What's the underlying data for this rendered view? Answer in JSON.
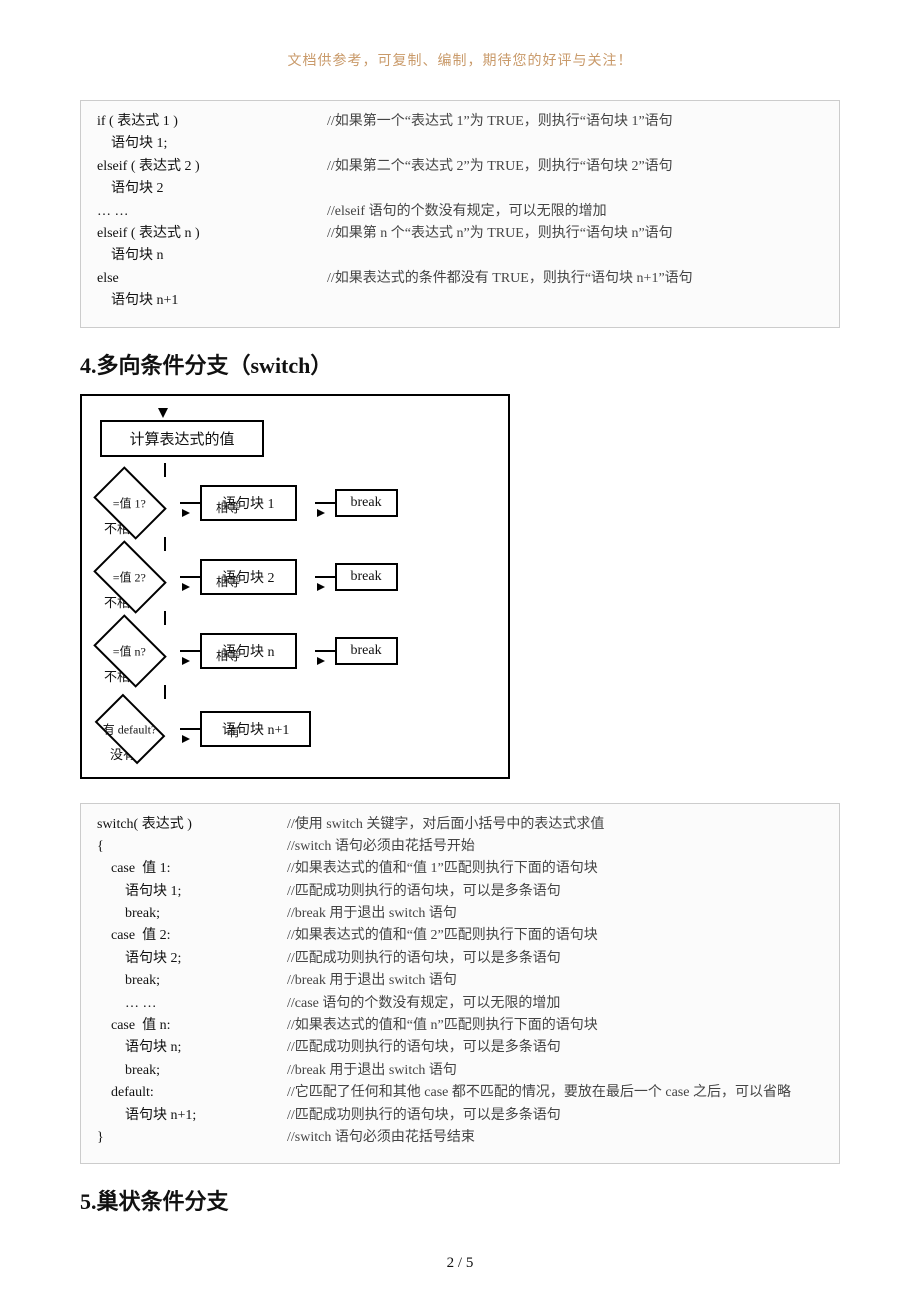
{
  "header_note": "文档供参考，可复制、编制，期待您的好评与关注！",
  "if_block": {
    "rows": [
      {
        "code": "if ( 表达式 1 )",
        "comment": "//如果第一个“表达式 1”为 TRUE，则执行“语句块 1”语句"
      },
      {
        "code": "    语句块 1;",
        "comment": ""
      },
      {
        "code": "elseif ( 表达式 2 )",
        "comment": "//如果第二个“表达式 2”为 TRUE，则执行“语句块 2”语句"
      },
      {
        "code": "    语句块 2",
        "comment": ""
      },
      {
        "code": "… …",
        "comment": "//elseif 语句的个数没有规定，可以无限的增加"
      },
      {
        "code": "elseif ( 表达式 n )",
        "comment": "//如果第 n 个“表达式 n”为 TRUE，则执行“语句块 n”语句"
      },
      {
        "code": "    语句块 n",
        "comment": ""
      },
      {
        "code": "else",
        "comment": "//如果表达式的条件都没有 TRUE，则执行“语句块 n+1”语句"
      },
      {
        "code": "    语句块 n+1",
        "comment": ""
      }
    ]
  },
  "section4_title": "4.多向条件分支（switch）",
  "flowchart": {
    "start": "计算表达式的值",
    "eq_label": "相等",
    "neq_label": "不相等",
    "has_label": "有",
    "none_label": "没有",
    "nodes": [
      {
        "q": "=值 1?",
        "stmt": "语句块 1",
        "brk": "break"
      },
      {
        "q": "=值 2?",
        "stmt": "语句块 2",
        "brk": "break"
      },
      {
        "q": "=值 n?",
        "stmt": "语句块 n",
        "brk": "break"
      }
    ],
    "default_q": "有 default?",
    "default_stmt": "语句块 n+1"
  },
  "switch_block": {
    "rows": [
      {
        "code": "switch( 表达式 )",
        "comment": "//使用 switch 关键字，对后面小括号中的表达式求值"
      },
      {
        "code": "{",
        "comment": "//switch 语句必须由花括号开始"
      },
      {
        "code": "    case  值 1:",
        "comment": "//如果表达式的值和“值 1”匹配则执行下面的语句块"
      },
      {
        "code": "        语句块 1;",
        "comment": "//匹配成功则执行的语句块，可以是多条语句"
      },
      {
        "code": "        break;",
        "comment": "//break 用于退出 switch 语句"
      },
      {
        "code": "    case  值 2:",
        "comment": "//如果表达式的值和“值 2”匹配则执行下面的语句块"
      },
      {
        "code": "        语句块 2;",
        "comment": "//匹配成功则执行的语句块，可以是多条语句"
      },
      {
        "code": "        break;",
        "comment": "//break 用于退出 switch 语句"
      },
      {
        "code": "        … …",
        "comment": "//case 语句的个数没有规定，可以无限的增加"
      },
      {
        "code": "    case  值 n:",
        "comment": "//如果表达式的值和“值 n”匹配则执行下面的语句块"
      },
      {
        "code": "        语句块 n;",
        "comment": "//匹配成功则执行的语句块，可以是多条语句"
      },
      {
        "code": "        break;",
        "comment": "//break 用于退出 switch 语句"
      },
      {
        "code": "    default:",
        "comment": "//它匹配了任何和其他 case 都不匹配的情况，要放在最后一个 case 之后，可以省略"
      },
      {
        "code": "        语句块 n+1;",
        "comment": "//匹配成功则执行的语句块，可以是多条语句"
      },
      {
        "code": "}",
        "comment": "//switch 语句必须由花括号结束"
      }
    ]
  },
  "section5_title": "5.巢状条件分支",
  "footer": "2 / 5"
}
